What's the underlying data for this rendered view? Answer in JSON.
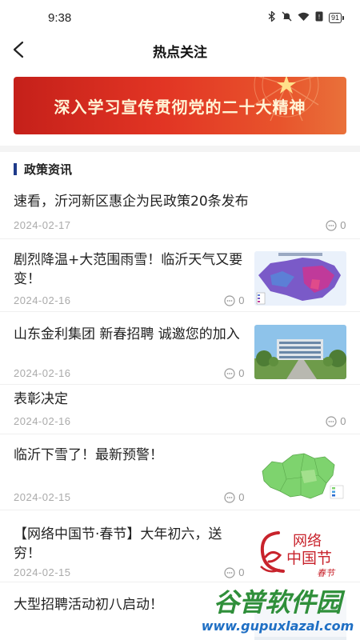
{
  "status_bar": {
    "time": "9:38",
    "battery": "91",
    "icons": [
      "bluetooth-icon",
      "mute-icon",
      "wifi-icon",
      "sim-icon",
      "battery-icon"
    ]
  },
  "nav": {
    "title": "热点关注",
    "back_icon": "chevron-left-icon"
  },
  "banner": {
    "text": "深入学习宣传贯彻党的二十大精神",
    "colors": [
      "#c5201a",
      "#e9713a"
    ]
  },
  "section": {
    "title": "政策资讯",
    "accent": "#1f3a8a"
  },
  "news": [
    {
      "title": "速看，沂河新区惠企为民政策20条发布",
      "date": "2024-02-17",
      "comments": "0",
      "thumb": null
    },
    {
      "title": "剧烈降温+大范围雨雪！临沂天气又要变！",
      "date": "2024-02-16",
      "comments": "0",
      "thumb": "weather-map"
    },
    {
      "title": "山东金利集团  新春招聘  诚邀您的加入",
      "date": "2024-02-16",
      "comments": "0",
      "thumb": "building-photo"
    },
    {
      "title": "表彰决定",
      "date": "2024-02-16",
      "comments": "0",
      "thumb": null
    },
    {
      "title": "临沂下雪了！最新预警！",
      "date": "2024-02-15",
      "comments": "0",
      "thumb": "region-map"
    },
    {
      "title": "【网络中国节·春节】大年初六，送穷！",
      "date": "2024-02-15",
      "comments": "0",
      "thumb": "festival-logo",
      "thumb_text_1": "网络",
      "thumb_text_2": "中国节",
      "thumb_text_3": "春节"
    },
    {
      "title": "大型招聘活动初八启动！",
      "date": "2024-02-15",
      "comments": "0",
      "thumb": "partial"
    }
  ],
  "watermark": {
    "line1": "谷普软件园",
    "line2": "www.gupuxlazal.com"
  }
}
